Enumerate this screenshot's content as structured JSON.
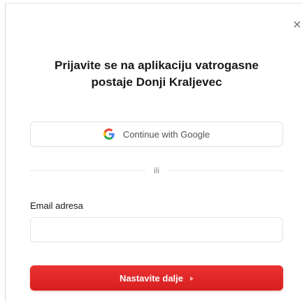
{
  "dialog": {
    "close_symbol": "×",
    "title_line1": "Prijavite se na aplikaciju vatrogasne",
    "title_line2": "postaje Donji Kraljevec"
  },
  "google": {
    "label": "Continue with Google",
    "icon": "google-g-icon"
  },
  "divider": {
    "text": "ili"
  },
  "email": {
    "label": "Email adresa",
    "value": "",
    "placeholder": ""
  },
  "submit": {
    "label": "Nastavite dalje",
    "icon": "caret-right-icon",
    "color": "#e02626"
  }
}
